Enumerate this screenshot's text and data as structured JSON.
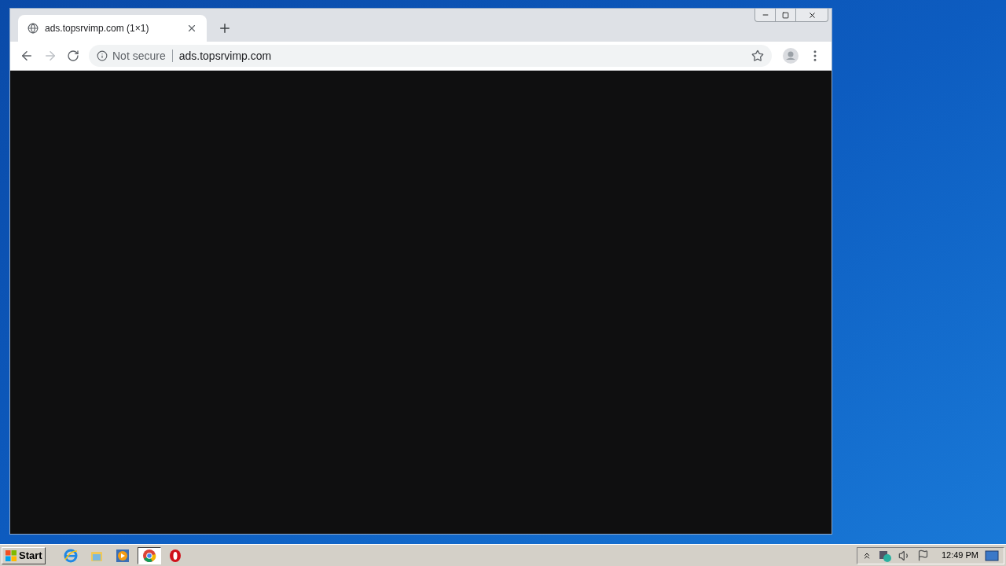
{
  "browser": {
    "tab": {
      "title": "ads.topsrvimp.com (1×1)",
      "selected": true
    },
    "address": {
      "security": "Not secure",
      "url": "ads.topsrvimp.com"
    }
  },
  "taskbar": {
    "start": "Start",
    "apps": [
      {
        "kind": "ie",
        "selected": false
      },
      {
        "kind": "explorer",
        "selected": false
      },
      {
        "kind": "media",
        "selected": false
      },
      {
        "kind": "chrome",
        "selected": true
      },
      {
        "kind": "opera",
        "selected": false
      }
    ],
    "clock": "12:49 PM"
  }
}
